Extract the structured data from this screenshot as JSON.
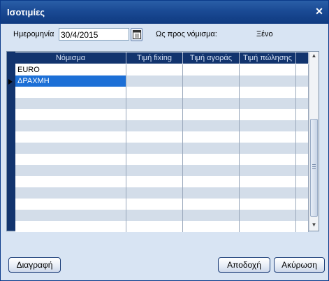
{
  "window": {
    "title": "Ισοτιμίες",
    "close_glyph": "✕"
  },
  "filter": {
    "date_label": "Ημερομηνία",
    "date_value": "30/4/2015",
    "currency_label": "Ως προς νόμισμα:",
    "currency_value": "Ξένο"
  },
  "grid": {
    "columns": [
      "Νόμισμα",
      "Τιμή fixing",
      "Τιμή αγοράς",
      "Τιμή πώλησης"
    ],
    "rows": [
      [
        "EURO",
        "",
        "",
        ""
      ],
      [
        "ΔΡΑΧΜΗ",
        "",
        "",
        ""
      ]
    ],
    "selected_row": 1
  },
  "buttons": {
    "delete": "Διαγραφή",
    "accept": "Αποδοχή",
    "cancel": "Ακύρωση"
  },
  "colors": {
    "header_bg": "#12346e",
    "selection": "#1c6fd6",
    "window_bg": "#d8e4f3"
  }
}
